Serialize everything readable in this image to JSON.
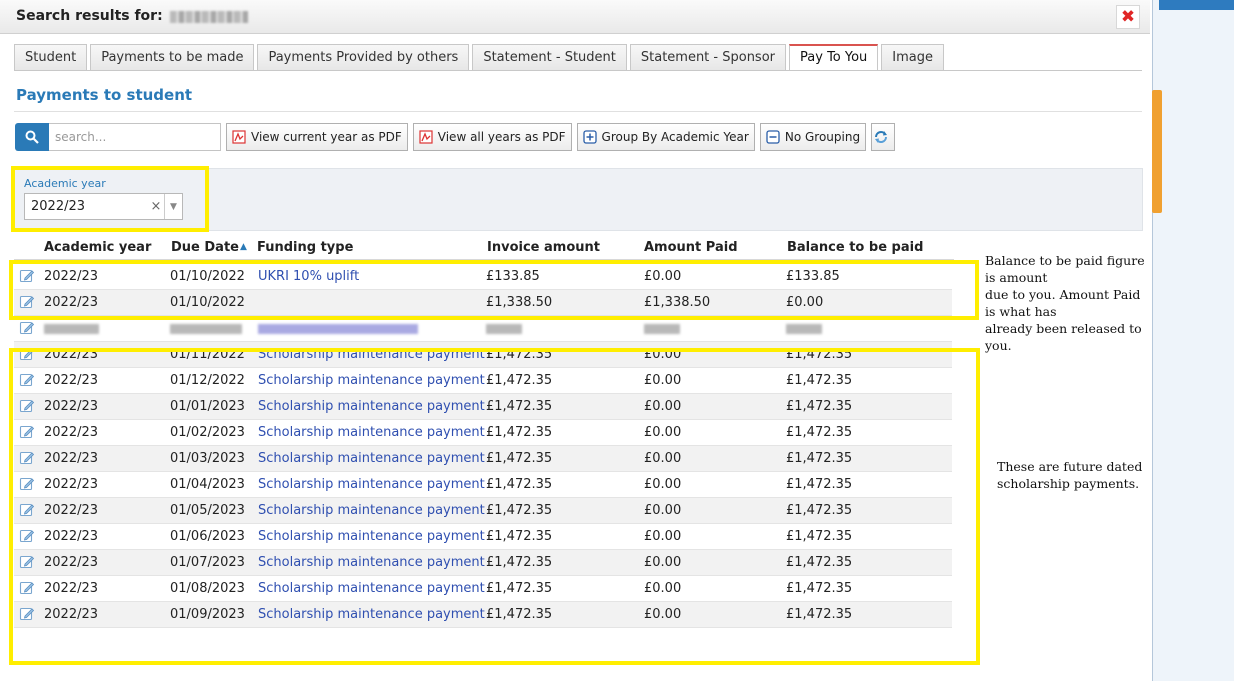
{
  "dialog": {
    "title": "Search results for:",
    "close_icon": "close-icon"
  },
  "tabs": [
    {
      "label": "Student",
      "active": false
    },
    {
      "label": "Payments to be made",
      "active": false
    },
    {
      "label": "Payments Provided by others",
      "active": false
    },
    {
      "label": "Statement - Student",
      "active": false
    },
    {
      "label": "Statement - Sponsor",
      "active": false
    },
    {
      "label": "Pay To You",
      "active": true
    },
    {
      "label": "Image",
      "active": false
    }
  ],
  "section": {
    "title": "Payments to student"
  },
  "toolbar": {
    "search_placeholder": "search...",
    "search_icon": "search-icon",
    "view_current_pdf": "View current year as PDF",
    "view_all_pdf": "View all years as PDF",
    "group_by_year": "Group By Academic Year",
    "no_grouping": "No Grouping",
    "refresh_icon": "refresh-icon"
  },
  "filter": {
    "label": "Academic year",
    "value": "2022/23",
    "clear": "×",
    "arrow": "▼"
  },
  "table": {
    "headers": {
      "academic_year": "Academic year",
      "due_date": "Due Date",
      "sort_icon": "▲",
      "funding_type": "Funding type",
      "invoice_amount": "Invoice amount",
      "amount_paid": "Amount Paid",
      "balance": "Balance to be paid"
    },
    "rows": [
      {
        "year": "2022/23",
        "due": "01/10/2022",
        "type": "UKRI 10% uplift",
        "invoice": "£133.85",
        "paid": "£0.00",
        "balance": "£133.85"
      },
      {
        "year": "2022/23",
        "due": "01/10/2022",
        "type": "",
        "invoice": "£1,338.50",
        "paid": "£1,338.50",
        "balance": "£0.00"
      },
      {
        "year": "2022/23",
        "due": "01/11/2022",
        "type": "Scholarship maintenance payment",
        "invoice": "£1,472.35",
        "paid": "£0.00",
        "balance": "£1,472.35"
      },
      {
        "year": "2022/23",
        "due": "01/12/2022",
        "type": "Scholarship maintenance payment",
        "invoice": "£1,472.35",
        "paid": "£0.00",
        "balance": "£1,472.35"
      },
      {
        "year": "2022/23",
        "due": "01/01/2023",
        "type": "Scholarship maintenance payment",
        "invoice": "£1,472.35",
        "paid": "£0.00",
        "balance": "£1,472.35"
      },
      {
        "year": "2022/23",
        "due": "01/02/2023",
        "type": "Scholarship maintenance payment",
        "invoice": "£1,472.35",
        "paid": "£0.00",
        "balance": "£1,472.35"
      },
      {
        "year": "2022/23",
        "due": "01/03/2023",
        "type": "Scholarship maintenance payment",
        "invoice": "£1,472.35",
        "paid": "£0.00",
        "balance": "£1,472.35"
      },
      {
        "year": "2022/23",
        "due": "01/04/2023",
        "type": "Scholarship maintenance payment",
        "invoice": "£1,472.35",
        "paid": "£0.00",
        "balance": "£1,472.35"
      },
      {
        "year": "2022/23",
        "due": "01/05/2023",
        "type": "Scholarship maintenance payment",
        "invoice": "£1,472.35",
        "paid": "£0.00",
        "balance": "£1,472.35"
      },
      {
        "year": "2022/23",
        "due": "01/06/2023",
        "type": "Scholarship maintenance payment",
        "invoice": "£1,472.35",
        "paid": "£0.00",
        "balance": "£1,472.35"
      },
      {
        "year": "2022/23",
        "due": "01/07/2023",
        "type": "Scholarship maintenance payment",
        "invoice": "£1,472.35",
        "paid": "£0.00",
        "balance": "£1,472.35"
      },
      {
        "year": "2022/23",
        "due": "01/08/2023",
        "type": "Scholarship maintenance payment",
        "invoice": "£1,472.35",
        "paid": "£0.00",
        "balance": "£1,472.35"
      },
      {
        "year": "2022/23",
        "due": "01/09/2023",
        "type": "Scholarship maintenance payment",
        "invoice": "£1,472.35",
        "paid": "£0.00",
        "balance": "£1,472.35"
      }
    ]
  },
  "annotations": {
    "balance_note": [
      "Balance to be paid figure is amount",
      "due to you. Amount Paid is what has",
      "already been released to you."
    ],
    "future_note": [
      "These are future dated",
      "scholarship payments."
    ]
  },
  "colors": {
    "accent": "#2a7ab7",
    "highlight": "#ffee00",
    "active_tab_border": "#d9534f",
    "link": "#2f4fb0"
  }
}
